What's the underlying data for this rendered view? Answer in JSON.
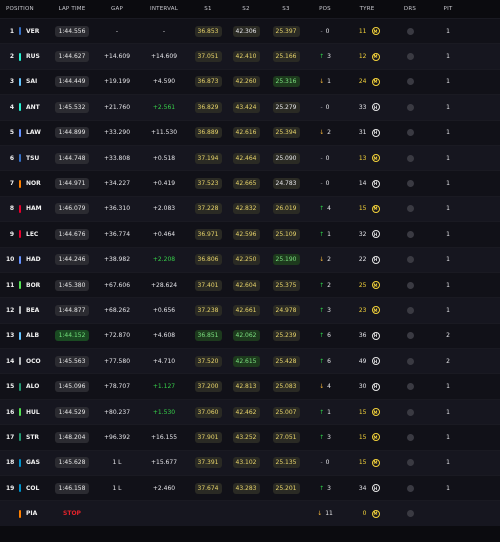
{
  "header": {
    "position": "POSITION",
    "lap_time": "LAP TIME",
    "gap": "GAP",
    "interval": "INTERVAL",
    "s1": "S1",
    "s2": "S2",
    "s3": "S3",
    "pos": "POS",
    "tyre": "TYRE",
    "drs": "DRS",
    "pit": "PIT"
  },
  "colors": {
    "background": "#0b0b0f",
    "purple_sector": "#7be07f",
    "yellow_sector": "#e8d46a",
    "gain": "#2fd04a",
    "loss": "#f3b43a",
    "stop": "#e2232b"
  },
  "rows": [
    {
      "num": "1",
      "code": "VER",
      "team_color": "#3671c6",
      "lap": "1:44.556",
      "gap": "-",
      "interval": "-",
      "s1": "36.853",
      "s2": "42.306",
      "s3": "25.397",
      "s1c": "yellow",
      "s2c": "white",
      "s3c": "yellow",
      "posdir": "eq",
      "poschg": "0",
      "tlaps": "11",
      "tyre": "M",
      "drs": "",
      "pit": "1",
      "lapc": "",
      "intc": ""
    },
    {
      "num": "2",
      "code": "RUS",
      "team_color": "#27f4d2",
      "lap": "1:44.627",
      "gap": "+14.609",
      "interval": "+14.609",
      "s1": "37.051",
      "s2": "42.410",
      "s3": "25.166",
      "s1c": "yellow",
      "s2c": "yellow",
      "s3c": "yellow",
      "posdir": "up",
      "poschg": "3",
      "tlaps": "12",
      "tyre": "M",
      "drs": "",
      "pit": "1",
      "lapc": "",
      "intc": ""
    },
    {
      "num": "3",
      "code": "SAI",
      "team_color": "#64c4ff",
      "lap": "1:44.449",
      "gap": "+19.199",
      "interval": "+4.590",
      "s1": "36.873",
      "s2": "42.260",
      "s3": "25.316",
      "s1c": "yellow",
      "s2c": "yellow",
      "s3c": "green",
      "posdir": "down",
      "poschg": "1",
      "tlaps": "24",
      "tyre": "M",
      "drs": "",
      "pit": "1",
      "lapc": "",
      "intc": ""
    },
    {
      "num": "4",
      "code": "ANT",
      "team_color": "#27f4d2",
      "lap": "1:45.532",
      "gap": "+21.760",
      "interval": "+2.561",
      "s1": "36.829",
      "s2": "43.424",
      "s3": "25.279",
      "s1c": "yellow",
      "s2c": "yellow",
      "s3c": "white",
      "posdir": "eq",
      "poschg": "0",
      "tlaps": "33",
      "tyre": "H",
      "drs": "",
      "pit": "1",
      "lapc": "",
      "intc": "green"
    },
    {
      "num": "5",
      "code": "LAW",
      "team_color": "#6692ff",
      "lap": "1:44.899",
      "gap": "+33.290",
      "interval": "+11.530",
      "s1": "36.889",
      "s2": "42.616",
      "s3": "25.394",
      "s1c": "yellow",
      "s2c": "yellow",
      "s3c": "yellow",
      "posdir": "down",
      "poschg": "2",
      "tlaps": "31",
      "tyre": "H",
      "drs": "",
      "pit": "1",
      "lapc": "",
      "intc": ""
    },
    {
      "num": "6",
      "code": "TSU",
      "team_color": "#3671c6",
      "lap": "1:44.748",
      "gap": "+33.808",
      "interval": "+0.518",
      "s1": "37.194",
      "s2": "42.464",
      "s3": "25.090",
      "s1c": "yellow",
      "s2c": "yellow",
      "s3c": "white",
      "posdir": "eq",
      "poschg": "0",
      "tlaps": "13",
      "tyre": "M",
      "drs": "",
      "pit": "1",
      "lapc": "",
      "intc": ""
    },
    {
      "num": "7",
      "code": "NOR",
      "team_color": "#ff8000",
      "lap": "1:44.971",
      "gap": "+34.227",
      "interval": "+0.419",
      "s1": "37.523",
      "s2": "42.665",
      "s3": "24.783",
      "s1c": "yellow",
      "s2c": "yellow",
      "s3c": "white",
      "posdir": "eq",
      "poschg": "0",
      "tlaps": "14",
      "tyre": "H",
      "drs": "",
      "pit": "1",
      "lapc": "",
      "intc": ""
    },
    {
      "num": "8",
      "code": "HAM",
      "team_color": "#e8002d",
      "lap": "1:46.079",
      "gap": "+36.310",
      "interval": "+2.083",
      "s1": "37.228",
      "s2": "42.832",
      "s3": "26.019",
      "s1c": "yellow",
      "s2c": "yellow",
      "s3c": "yellow",
      "posdir": "up",
      "poschg": "4",
      "tlaps": "15",
      "tyre": "M",
      "drs": "",
      "pit": "1",
      "lapc": "",
      "intc": ""
    },
    {
      "num": "9",
      "code": "LEC",
      "team_color": "#e8002d",
      "lap": "1:44.676",
      "gap": "+36.774",
      "interval": "+0.464",
      "s1": "36.971",
      "s2": "42.596",
      "s3": "25.109",
      "s1c": "yellow",
      "s2c": "yellow",
      "s3c": "yellow",
      "posdir": "up",
      "poschg": "1",
      "tlaps": "32",
      "tyre": "H",
      "drs": "",
      "pit": "1",
      "lapc": "",
      "intc": ""
    },
    {
      "num": "10",
      "code": "HAD",
      "team_color": "#6692ff",
      "lap": "1:44.246",
      "gap": "+38.982",
      "interval": "+2.208",
      "s1": "36.806",
      "s2": "42.250",
      "s3": "25.190",
      "s1c": "yellow",
      "s2c": "yellow",
      "s3c": "green",
      "posdir": "down",
      "poschg": "2",
      "tlaps": "22",
      "tyre": "H",
      "drs": "",
      "pit": "1",
      "lapc": "",
      "intc": "green"
    },
    {
      "num": "11",
      "code": "BOR",
      "team_color": "#52e252",
      "lap": "1:45.380",
      "gap": "+67.606",
      "interval": "+28.624",
      "s1": "37.401",
      "s2": "42.604",
      "s3": "25.375",
      "s1c": "yellow",
      "s2c": "yellow",
      "s3c": "yellow",
      "posdir": "up",
      "poschg": "2",
      "tlaps": "25",
      "tyre": "M",
      "drs": "",
      "pit": "1",
      "lapc": "",
      "intc": ""
    },
    {
      "num": "12",
      "code": "BEA",
      "team_color": "#b6babd",
      "lap": "1:44.877",
      "gap": "+68.262",
      "interval": "+0.656",
      "s1": "37.238",
      "s2": "42.661",
      "s3": "24.978",
      "s1c": "yellow",
      "s2c": "yellow",
      "s3c": "yellow",
      "posdir": "up",
      "poschg": "3",
      "tlaps": "23",
      "tyre": "M",
      "drs": "",
      "pit": "1",
      "lapc": "",
      "intc": ""
    },
    {
      "num": "13",
      "code": "ALB",
      "team_color": "#64c4ff",
      "lap": "1:44.152",
      "gap": "+72.870",
      "interval": "+4.608",
      "s1": "36.851",
      "s2": "42.062",
      "s3": "25.239",
      "s1c": "green",
      "s2c": "green",
      "s3c": "yellow",
      "posdir": "up",
      "poschg": "6",
      "tlaps": "36",
      "tyre": "H",
      "drs": "",
      "pit": "2",
      "lapc": "green",
      "intc": ""
    },
    {
      "num": "14",
      "code": "OCO",
      "team_color": "#b6babd",
      "lap": "1:45.563",
      "gap": "+77.580",
      "interval": "+4.710",
      "s1": "37.520",
      "s2": "42.615",
      "s3": "25.428",
      "s1c": "yellow",
      "s2c": "green",
      "s3c": "yellow",
      "posdir": "up",
      "poschg": "6",
      "tlaps": "49",
      "tyre": "H",
      "drs": "",
      "pit": "2",
      "lapc": "",
      "intc": ""
    },
    {
      "num": "15",
      "code": "ALO",
      "team_color": "#229971",
      "lap": "1:45.096",
      "gap": "+78.707",
      "interval": "+1.127",
      "s1": "37.200",
      "s2": "42.813",
      "s3": "25.083",
      "s1c": "yellow",
      "s2c": "yellow",
      "s3c": "yellow",
      "posdir": "down",
      "poschg": "4",
      "tlaps": "30",
      "tyre": "H",
      "drs": "",
      "pit": "1",
      "lapc": "",
      "intc": "green"
    },
    {
      "num": "16",
      "code": "HUL",
      "team_color": "#52e252",
      "lap": "1:44.529",
      "gap": "+80.237",
      "interval": "+1.530",
      "s1": "37.060",
      "s2": "42.462",
      "s3": "25.007",
      "s1c": "yellow",
      "s2c": "yellow",
      "s3c": "yellow",
      "posdir": "up",
      "poschg": "1",
      "tlaps": "15",
      "tyre": "M",
      "drs": "",
      "pit": "1",
      "lapc": "",
      "intc": "green"
    },
    {
      "num": "17",
      "code": "STR",
      "team_color": "#229971",
      "lap": "1:48.204",
      "gap": "+96.392",
      "interval": "+16.155",
      "s1": "37.901",
      "s2": "43.252",
      "s3": "27.051",
      "s1c": "yellow",
      "s2c": "yellow",
      "s3c": "yellow",
      "posdir": "up",
      "poschg": "3",
      "tlaps": "15",
      "tyre": "M",
      "drs": "",
      "pit": "1",
      "lapc": "",
      "intc": ""
    },
    {
      "num": "18",
      "code": "GAS",
      "team_color": "#0093cc",
      "lap": "1:45.628",
      "gap": "1 L",
      "interval": "+15.677",
      "s1": "37.391",
      "s2": "43.102",
      "s3": "25.135",
      "s1c": "yellow",
      "s2c": "yellow",
      "s3c": "yellow",
      "posdir": "eq",
      "poschg": "0",
      "tlaps": "15",
      "tyre": "M",
      "drs": "",
      "pit": "1",
      "lapc": "",
      "intc": ""
    },
    {
      "num": "19",
      "code": "COL",
      "team_color": "#0093cc",
      "lap": "1:46.158",
      "gap": "1 L",
      "interval": "+2.460",
      "s1": "37.674",
      "s2": "43.283",
      "s3": "25.201",
      "s1c": "yellow",
      "s2c": "yellow",
      "s3c": "yellow",
      "posdir": "up",
      "poschg": "3",
      "tlaps": "34",
      "tyre": "H",
      "drs": "",
      "pit": "1",
      "lapc": "",
      "intc": ""
    },
    {
      "num": "",
      "code": "PIA",
      "team_color": "#ff8000",
      "lap": "STOP",
      "gap": "",
      "interval": "",
      "s1": "",
      "s2": "",
      "s3": "",
      "s1c": "",
      "s2c": "",
      "s3c": "",
      "posdir": "down",
      "poschg": "11",
      "tlaps": "0",
      "tyre": "M",
      "drs": "",
      "pit": "",
      "lapc": "stop",
      "intc": ""
    }
  ]
}
